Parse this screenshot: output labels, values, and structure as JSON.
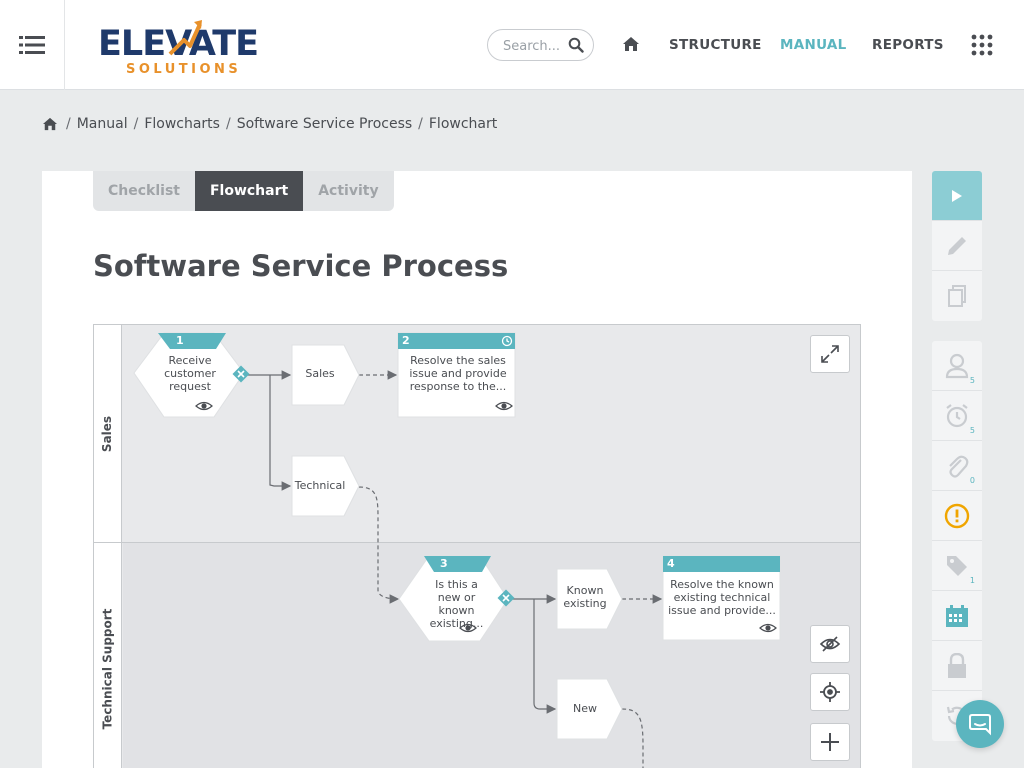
{
  "brand": {
    "name": "ELEVATE",
    "sub": "SOLUTIONS"
  },
  "search": {
    "placeholder": "Search..."
  },
  "nav": {
    "structure": "STRUCTURE",
    "manual": "MANUAL",
    "reports": "REPORTS"
  },
  "breadcrumb": [
    "Manual",
    "Flowcharts",
    "Software Service Process",
    "Flowchart"
  ],
  "tabs": {
    "checklist": "Checklist",
    "flowchart": "Flowchart",
    "activity": "Activity"
  },
  "title": "Software Service Process",
  "lanes": [
    "Sales",
    "Technical Support"
  ],
  "nodes": {
    "n1": {
      "num": "1",
      "text": "Receive customer request"
    },
    "n2": {
      "num": "2",
      "text": "Resolve the sales issue and provide response to the..."
    },
    "n3": {
      "num": "3",
      "text": "Is this a new or known existing..."
    },
    "n4": {
      "num": "4",
      "text": "Resolve the known existing technical issue and provide..."
    },
    "c_sales": "Sales",
    "c_technical": "Technical",
    "c_known": "Known existing",
    "c_new": "New"
  },
  "sidebar_counts": {
    "people": "5",
    "reminders": "5",
    "attachments": "0",
    "tags": "1"
  },
  "colors": {
    "accent": "#5bb5bf",
    "dark": "#4a4d52",
    "warning": "#f0a500",
    "brand_navy": "#1f3a6b",
    "brand_orange": "#e8912b"
  }
}
